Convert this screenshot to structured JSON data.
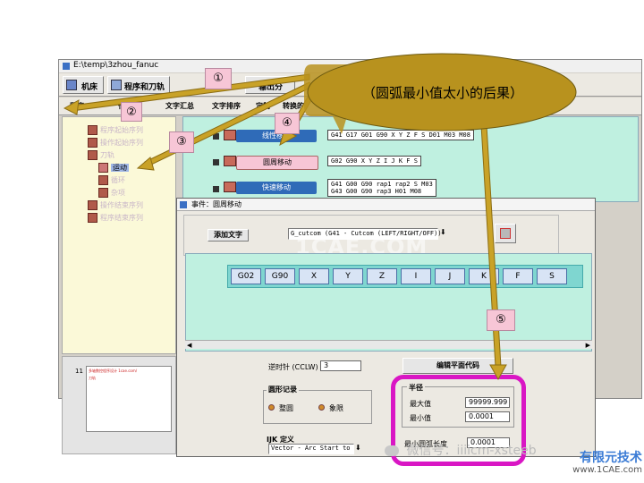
{
  "window": {
    "title": "E:\\temp\\3zhou_fanuc"
  },
  "toolbar": {
    "machine": "机床",
    "program_tool": "程序和刀轨",
    "output_trunc": "输出分"
  },
  "tabs": [
    "程序",
    "代码",
    "文字汇总",
    "文字排序",
    "定制",
    "转换的"
  ],
  "tree": {
    "items": [
      "程序起始序列",
      "操作起始序列",
      "刀轨",
      "运动",
      "循环",
      "杂项",
      "操作结束序列",
      "程序结束序列"
    ],
    "selected": "运动"
  },
  "nodes": [
    {
      "label": "线性移动",
      "code": "G41 G17 G01 G90 X Y Z F S D01 M03 M08"
    },
    {
      "label": "圆周移动",
      "code": "G02 G90 X Y Z I J K F S"
    },
    {
      "label": "快速移动",
      "code": "G41 G00 G90 rap1 rap2 S M03",
      "code2": "G43 G00 G90 rap3 H01 M08"
    }
  ],
  "dialog": {
    "title": "事件：圆周移动",
    "add_text": "添加文字",
    "dropdown": "G_cutcom  (G41 - Cutcom (LEFT/RIGHT/OFF))",
    "dropdown_arrow": "⬇",
    "watermark": "1CAE.COM",
    "buttons": [
      "G02",
      "G90",
      "X",
      "Y",
      "Z",
      "I",
      "J",
      "K",
      "F",
      "S"
    ],
    "ccw_label": "逆时针 (CCLW)",
    "ccw_value": "3",
    "edit_plane": "编辑平面代码",
    "arc_record": "圆形记录",
    "full_circle": "整圆",
    "quadrant": "象限",
    "ijk_def": "IJK 定义",
    "ijk_value": "Vector - Arc Start to",
    "ijk_arrow": "⬇",
    "radius": "半径",
    "max_label": "最大值",
    "max_value": "99999.999",
    "min_label": "最小值",
    "min_value": "0.0001",
    "min_arc_label": "最小圆弧长度",
    "min_arc_value": "0.0001"
  },
  "thumb": {
    "num": "11",
    "line1": "多轴数控程序设计 1cae.com/",
    "line2": "刀轨"
  },
  "callouts": {
    "c1": "①",
    "c2": "②",
    "c3": "③",
    "c4": "④",
    "c5": "⑤"
  },
  "bubble": "（圆弧最小值太小的后果）",
  "brand": {
    "wechat": "微信号：iiiicm-xsteeb",
    "logo_main": "有限元技术",
    "logo_sub": "www.1CAE.com"
  },
  "colors": {
    "arrow": "#c9a227",
    "bubble": "#b8921e",
    "highlight": "#d916c4",
    "teal": "#bff0e0"
  }
}
